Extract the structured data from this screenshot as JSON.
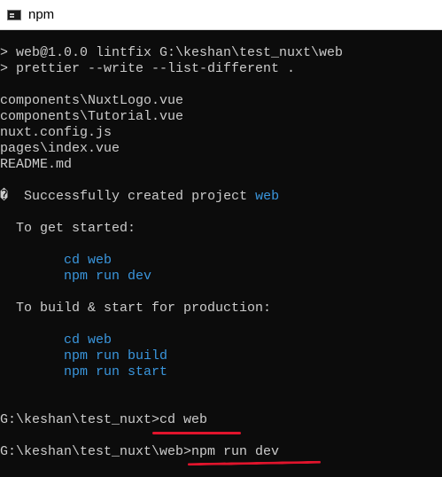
{
  "window": {
    "title": "npm",
    "icon": "console-icon"
  },
  "terminal": {
    "lines": [
      "> web@1.0.0 lintfix G:\\keshan\\test_nuxt\\web",
      "> prettier --write --list-different .",
      "components\\NuxtLogo.vue",
      "components\\Tutorial.vue",
      "nuxt.config.js",
      "pages\\index.vue",
      "README.md"
    ],
    "success": {
      "icon": "�",
      "message": "  Successfully created project ",
      "project": "web"
    },
    "get_started_label": "  To get started:",
    "get_started_cmds": [
      "cd web",
      "npm run dev"
    ],
    "build_label": "  To build & start for production:",
    "build_cmds": [
      "cd web",
      "npm run build",
      "npm run start"
    ],
    "prompt1": {
      "path": "G:\\keshan\\test_nuxt>",
      "command": "cd web"
    },
    "prompt2": {
      "path": "G:\\keshan\\test_nuxt\\web>",
      "command": "npm run dev"
    },
    "colors": {
      "background": "#0c0c0c",
      "text": "#cccccc",
      "accent": "#3a96dd",
      "annotation": "#e0142c"
    }
  }
}
